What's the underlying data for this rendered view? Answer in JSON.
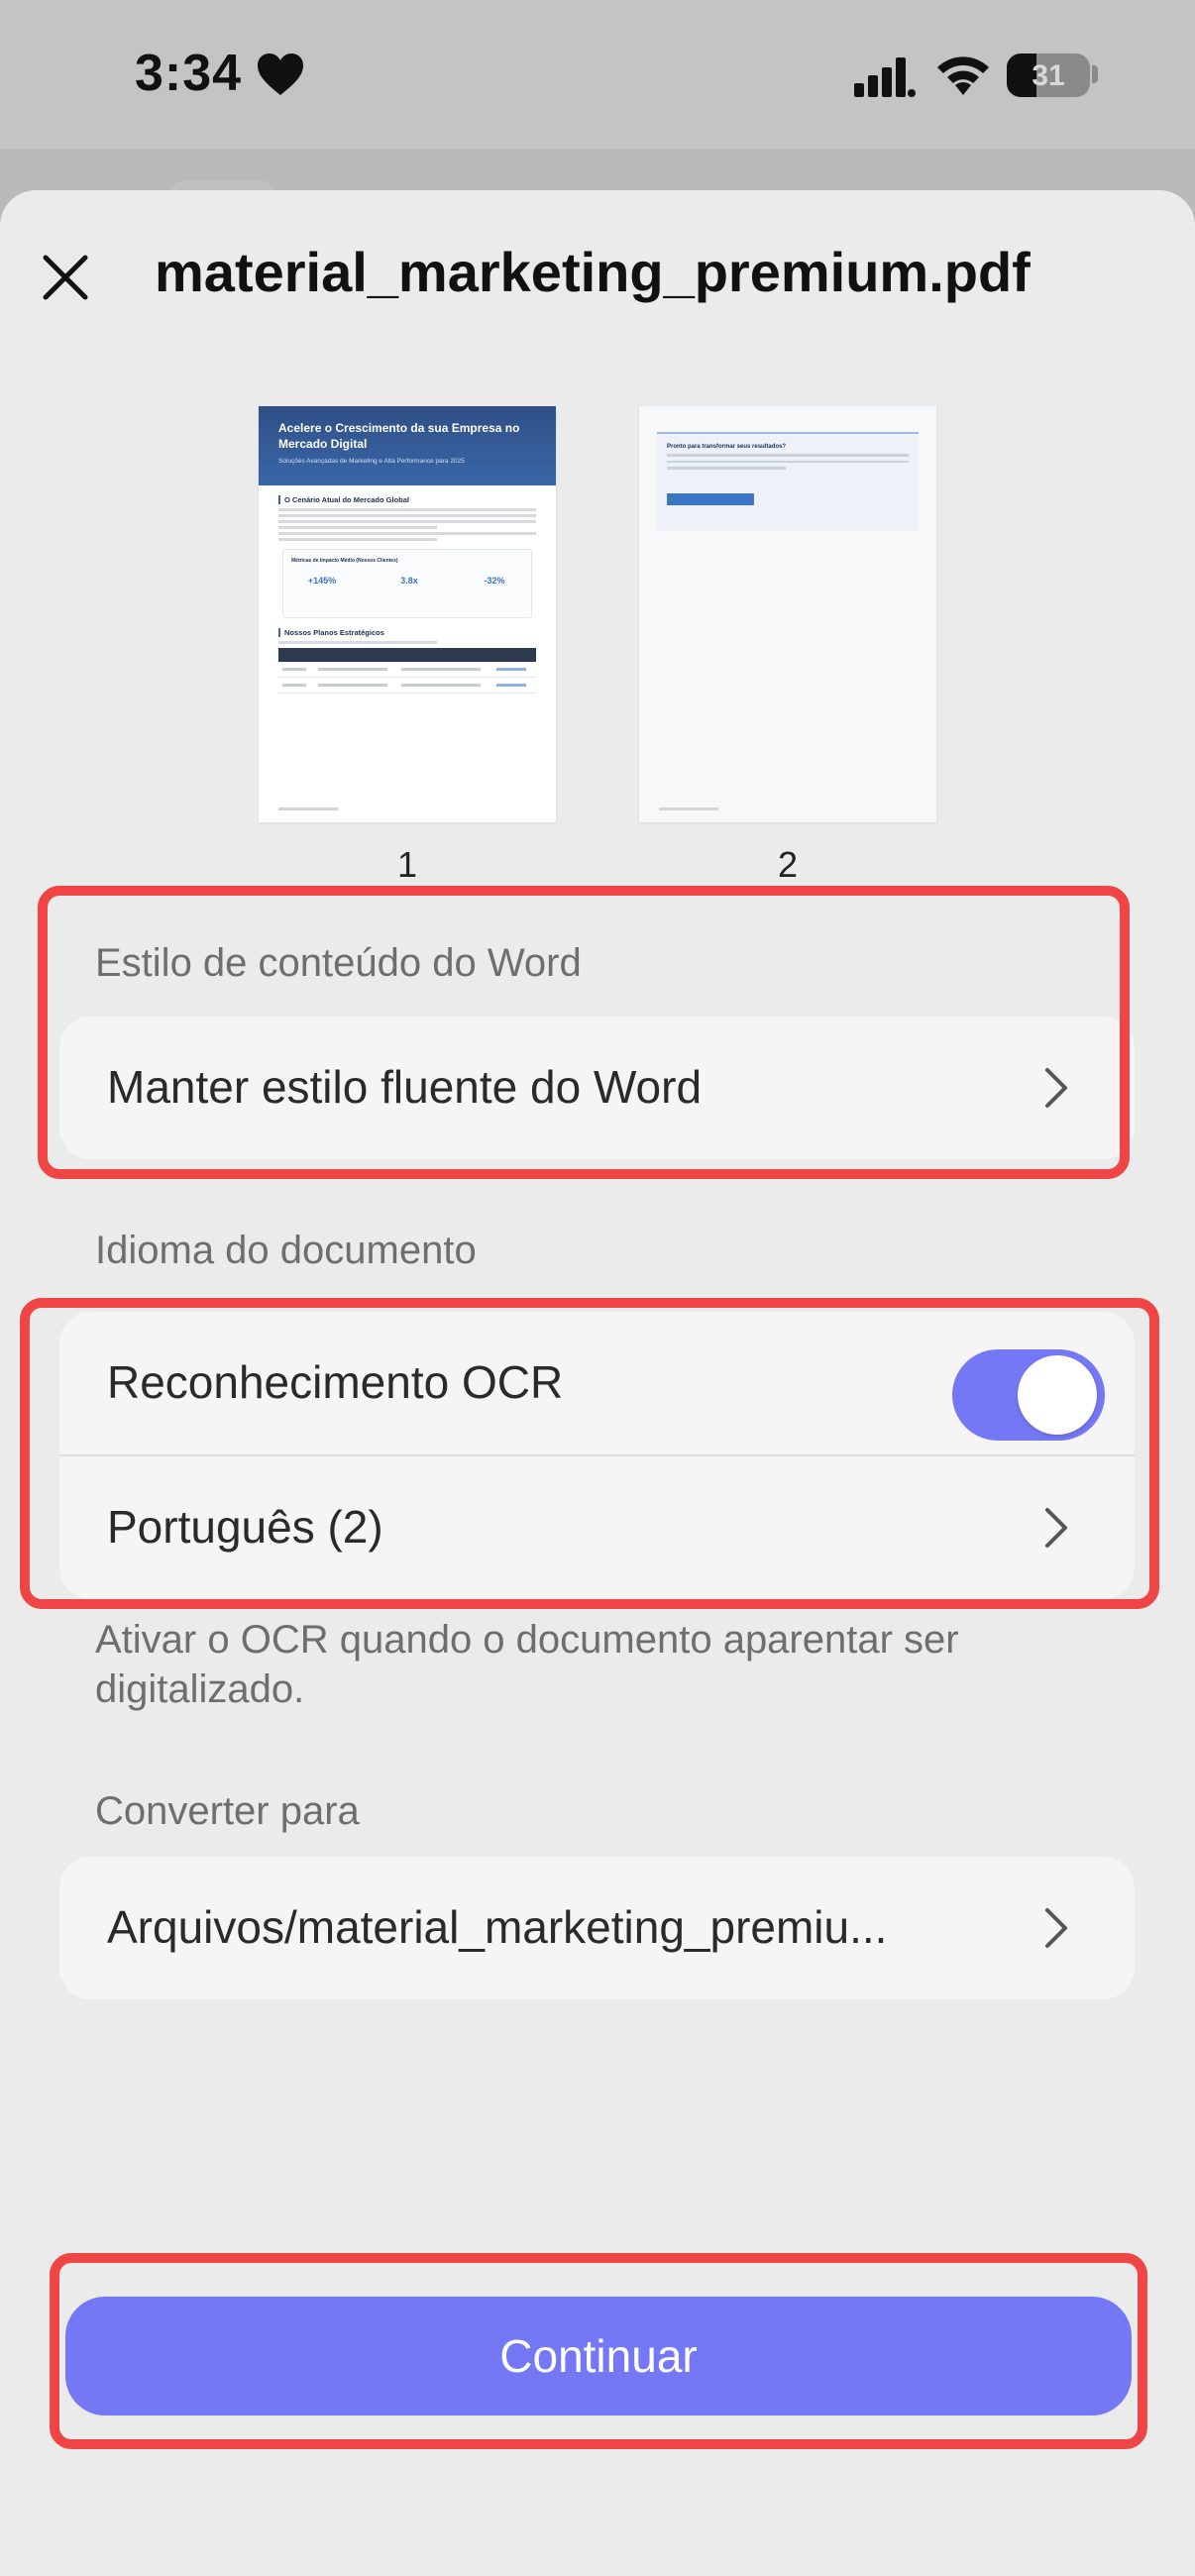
{
  "status_bar": {
    "time": "3:34",
    "battery_level": "31",
    "icons": [
      "heart-icon",
      "signal-icon",
      "wifi-icon",
      "battery-icon"
    ]
  },
  "sheet": {
    "title": "material_marketing_premium.pdf"
  },
  "preview": {
    "pages": [
      {
        "number": "1",
        "title": "Acelere o Crescimento da sua Empresa no Mercado Digital",
        "subtitle": "Soluções Avançadas de Marketing e Alta Performance para 2025",
        "section_1": "O Cenário Atual do Mercado Global",
        "metrics_title": "Métricas de Impacto Médio (Nossos Clientes)",
        "metrics": [
          "+145%",
          "3.8x",
          "-32%"
        ],
        "section_2": "Nossos Planos Estratégicos"
      },
      {
        "number": "2",
        "box_title": "Pronto para transformar seus resultados?"
      }
    ]
  },
  "word_style": {
    "label": "Estilo de conteúdo do Word",
    "value": "Manter estilo fluente do Word"
  },
  "document_language": {
    "label": "Idioma do documento",
    "ocr_label": "Reconhecimento OCR",
    "ocr_enabled": true,
    "language_value": "Português (2)",
    "hint": "Ativar o OCR quando o documento aparentar ser digitalizado."
  },
  "convert_to": {
    "label": "Converter para",
    "value": "Arquivos/material_marketing_premiu..."
  },
  "actions": {
    "continue_label": "Continuar"
  },
  "colors": {
    "accent": "#7578f5",
    "highlight": "#ef4545",
    "background": "#ebebeb",
    "card": "#f5f5f5"
  }
}
